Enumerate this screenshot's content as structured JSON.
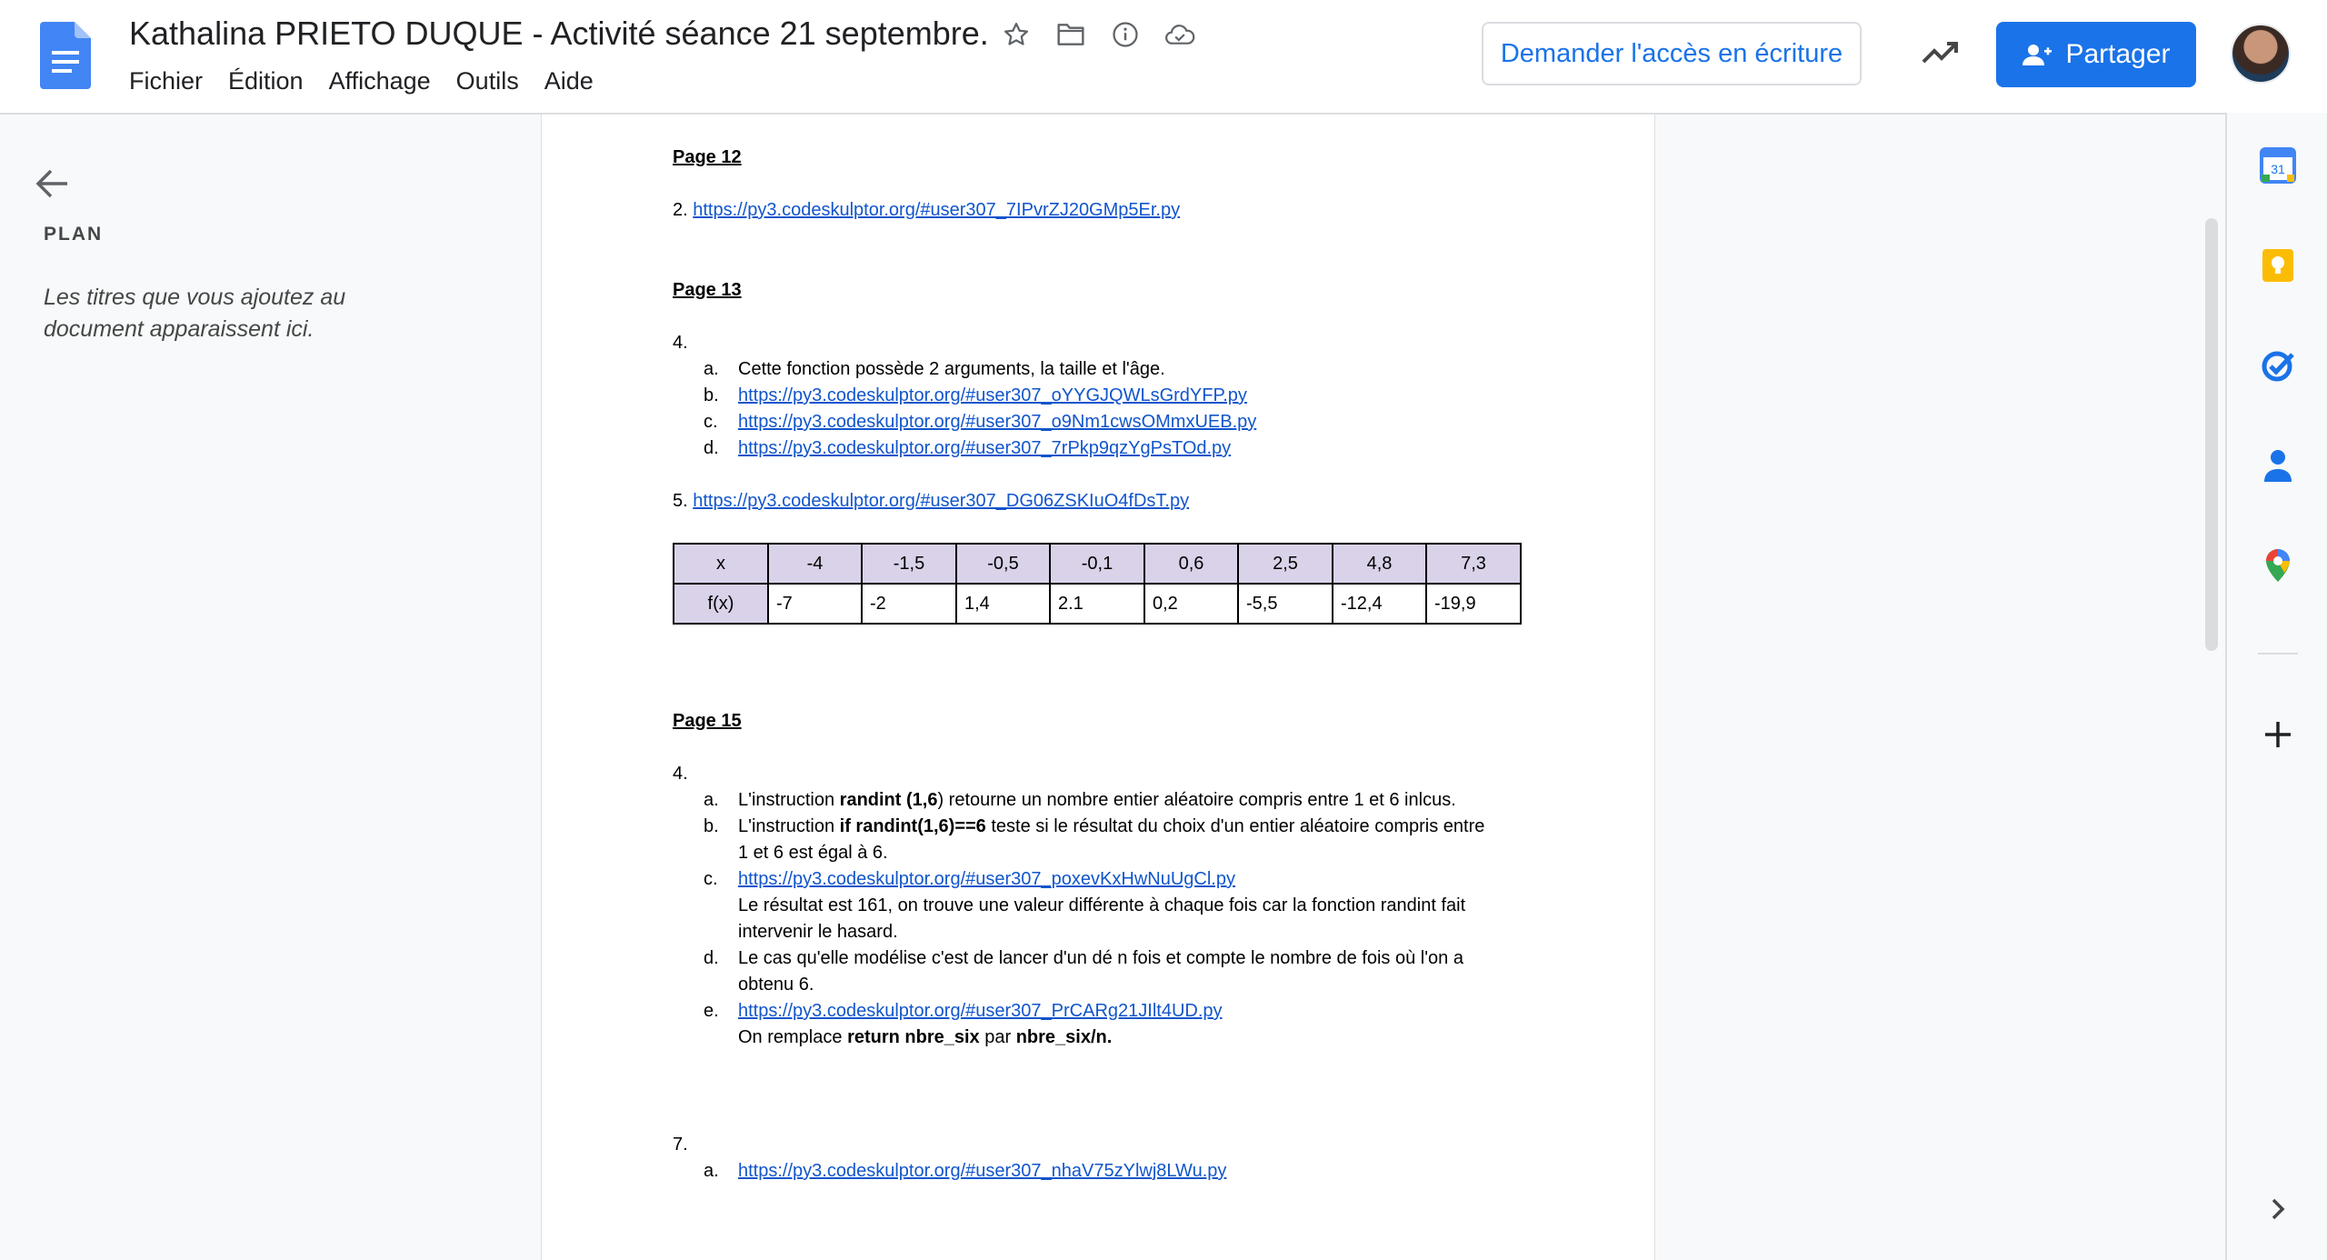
{
  "header": {
    "title": "Kathalina PRIETO DUQUE - Activité séance 21 septembre.",
    "menu": [
      "Fichier",
      "Édition",
      "Affichage",
      "Outils",
      "Aide"
    ],
    "request_access_label": "Demander l'accès en écriture",
    "share_label": "Partager"
  },
  "outline": {
    "label": "PLAN",
    "hint": "Les titres que vous ajoutez au document apparaissent ici."
  },
  "document": {
    "page12": {
      "heading": "Page 12",
      "item2_num": "2.",
      "item2_link": "https://py3.codeskulptor.org/#user307_7IPvrZJ20GMp5Er.py"
    },
    "page13": {
      "heading": "Page 13",
      "item4_num": "4.",
      "a_marker": "a.",
      "a_text": "Cette fonction possède 2 arguments, la taille et l'âge.",
      "b_marker": "b.",
      "b_link": "https://py3.codeskulptor.org/#user307_oYYGJQWLsGrdYFP.py",
      "c_marker": "c.",
      "c_link": "https://py3.codeskulptor.org/#user307_o9Nm1cwsOMmxUEB.py",
      "d_marker": "d.",
      "d_link": "https://py3.codeskulptor.org/#user307_7rPkp9qzYgPsTOd.py",
      "item5_num": "5.",
      "item5_link": "https://py3.codeskulptor.org/#user307_DG06ZSKIuO4fDsT.py"
    },
    "table": {
      "row_x": [
        "x",
        "-4",
        "-1,5",
        "-0,5",
        "-0,1",
        "0,6",
        "2,5",
        "4,8",
        "7,3"
      ],
      "row_fx": [
        "f(x)",
        "-7",
        "-2",
        "1,4",
        "2.1",
        "0,2",
        "-5,5",
        "-12,4",
        "-19,9"
      ]
    },
    "page15": {
      "heading": "Page 15",
      "item4_num": "4.",
      "a_marker": "a.",
      "a_pre": "L'instruction ",
      "a_bold": "randint (1,6",
      "a_post": ") retourne un nombre entier aléatoire compris entre 1 et 6 inlcus.",
      "b_marker": "b.",
      "b_pre": "L'instruction ",
      "b_bold": "if randint(1,6)==6",
      "b_post": " teste si le résultat du choix d'un entier aléatoire compris entre",
      "b_line2": "1 et 6 est égal à 6.",
      "c_marker": "c.",
      "c_link": "https://py3.codeskulptor.org/#user307_poxevKxHwNuUgCl.py",
      "c_line2": "Le résultat est 161, on trouve une valeur différente à chaque fois car la fonction randint fait",
      "c_line3": "intervenir le hasard.",
      "d_marker": "d.",
      "d_line1": "Le cas qu'elle modélise c'est de lancer d'un dé n fois et compte le nombre de fois où l'on a",
      "d_line2": "obtenu 6.",
      "e_marker": "e.",
      "e_link": "https://py3.codeskulptor.org/#user307_PrCARg21JIlt4UD.py",
      "e_pre": "On remplace ",
      "e_bold1": "return nbre_six",
      "e_mid": " par ",
      "e_bold2": "nbre_six/n.",
      "item7_num": "7.",
      "item7_a_marker": "a.",
      "item7_a_link": "https://py3.codeskulptor.org/#user307_nhaV75zYlwj8LWu.py"
    }
  },
  "colors": {
    "accent": "#1a73e8",
    "table_header": "#d9d2e9",
    "link": "#1155cc"
  },
  "side_panel_icons": [
    "calendar-icon",
    "keep-icon",
    "tasks-icon",
    "contacts-icon",
    "maps-icon",
    "add-icon",
    "expand-icon"
  ]
}
